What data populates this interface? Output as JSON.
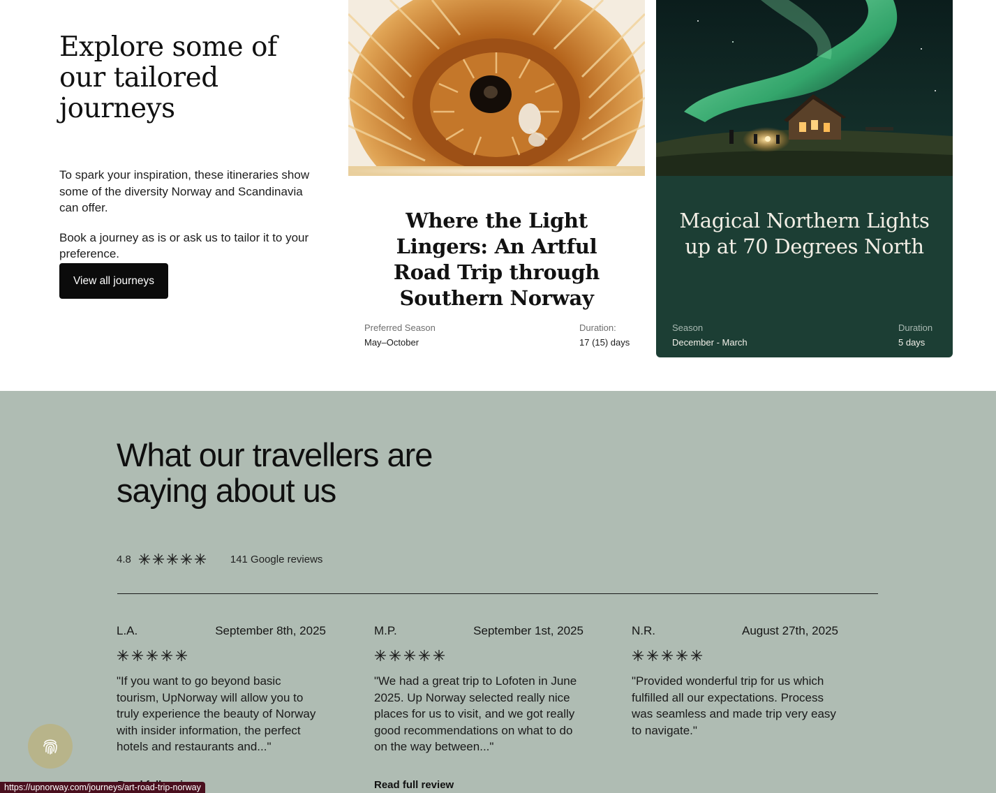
{
  "journeys": {
    "intro": {
      "heading": "Explore some of our tailored journeys",
      "paragraph_1": "To spark your inspiration, these itineraries show some of the diversity Norway and Scandinavia can offer.",
      "paragraph_2": "Book a journey as is or ask us to tailor it to your preference.",
      "cta_label": "View all journeys"
    },
    "cards": [
      {
        "title": "Where the Light Lingers: An Artful Road Trip through Southern Norway",
        "season_label": "Preferred Season",
        "season_value": "May–October",
        "duration_label": "Duration:",
        "duration_value": "17 (15) days"
      },
      {
        "title": "Magical Northern Lights up at 70 Degrees North",
        "season_label": "Season",
        "season_value": "December - March",
        "duration_label": "Duration",
        "duration_value": "5 days"
      }
    ]
  },
  "reviews": {
    "heading": "What our travellers are saying about us",
    "rating_value": "4.8",
    "rating_stars": 5,
    "rating_count": "141 Google reviews",
    "items": [
      {
        "name": "L.A.",
        "date": "September 8th, 2025",
        "stars": 5,
        "text": "\"If you want to go beyond basic tourism, UpNorway will allow you to truly experience the beauty of Norway with insider information, the perfect hotels and restaurants and...\"",
        "read_more": "Read full review"
      },
      {
        "name": "M.P.",
        "date": "September 1st, 2025",
        "stars": 5,
        "text": "\"We had a great trip to Lofoten in June 2025. Up Norway selected really nice places for us to visit, and we got really good recommendations on what to do on the way between...\"",
        "read_more": "Read full review"
      },
      {
        "name": "N.R.",
        "date": "August 27th, 2025",
        "stars": 5,
        "text": "\"Provided wonderful trip for us which fulfilled all our expectations. Process was seamless and made trip very easy to navigate.\""
      }
    ]
  },
  "status_bar": {
    "url": "https://upnorway.com/journeys/art-road-trip-norway"
  },
  "icons": {
    "star": "asterisk-star-icon",
    "privacy": "fingerprint-icon"
  },
  "colors": {
    "journey_card_dark": "#1c3e34",
    "reviews_background": "#afbcb3",
    "cta_background": "#0b0b0b",
    "privacy_button": "#b8b48a"
  }
}
